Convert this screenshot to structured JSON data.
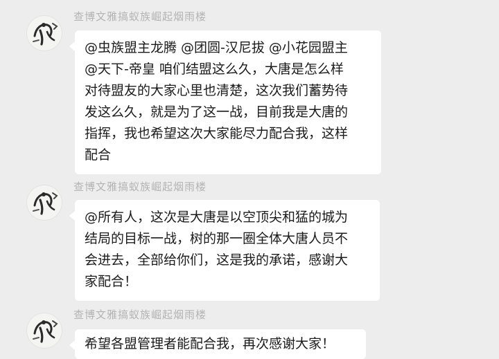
{
  "chat": {
    "messages": [
      {
        "sender": "查博文雅搞蚁族崛起烟雨楼",
        "lines": [
          "@虫族盟主龙腾 @团圆-汉尼拔 @小花园盟主",
          " @天下-帝皇 咱们结盟这么久，大唐是怎么样",
          "对待盟友的大家心里也清楚，这次我们蓄势待",
          "发这么久，就是为了这一战，目前我是大唐的",
          "指挥，我也希望这次大家能尽力配合我，这样",
          "配合"
        ]
      },
      {
        "sender": "查博文雅搞蚁族崛起烟雨楼",
        "lines": [
          "@所有人，这次是大唐是以空顶尖和猛的城为",
          "结局的目标一战，树的那一圈全体大唐人员不",
          "会进去，全部给你们，这是我的承诺，感谢大",
          "家配合！"
        ]
      },
      {
        "sender": "查博文雅搞蚁族崛起烟雨楼",
        "lines": [
          "希望各盟管理者能配合我，再次感谢大家！"
        ]
      }
    ]
  }
}
